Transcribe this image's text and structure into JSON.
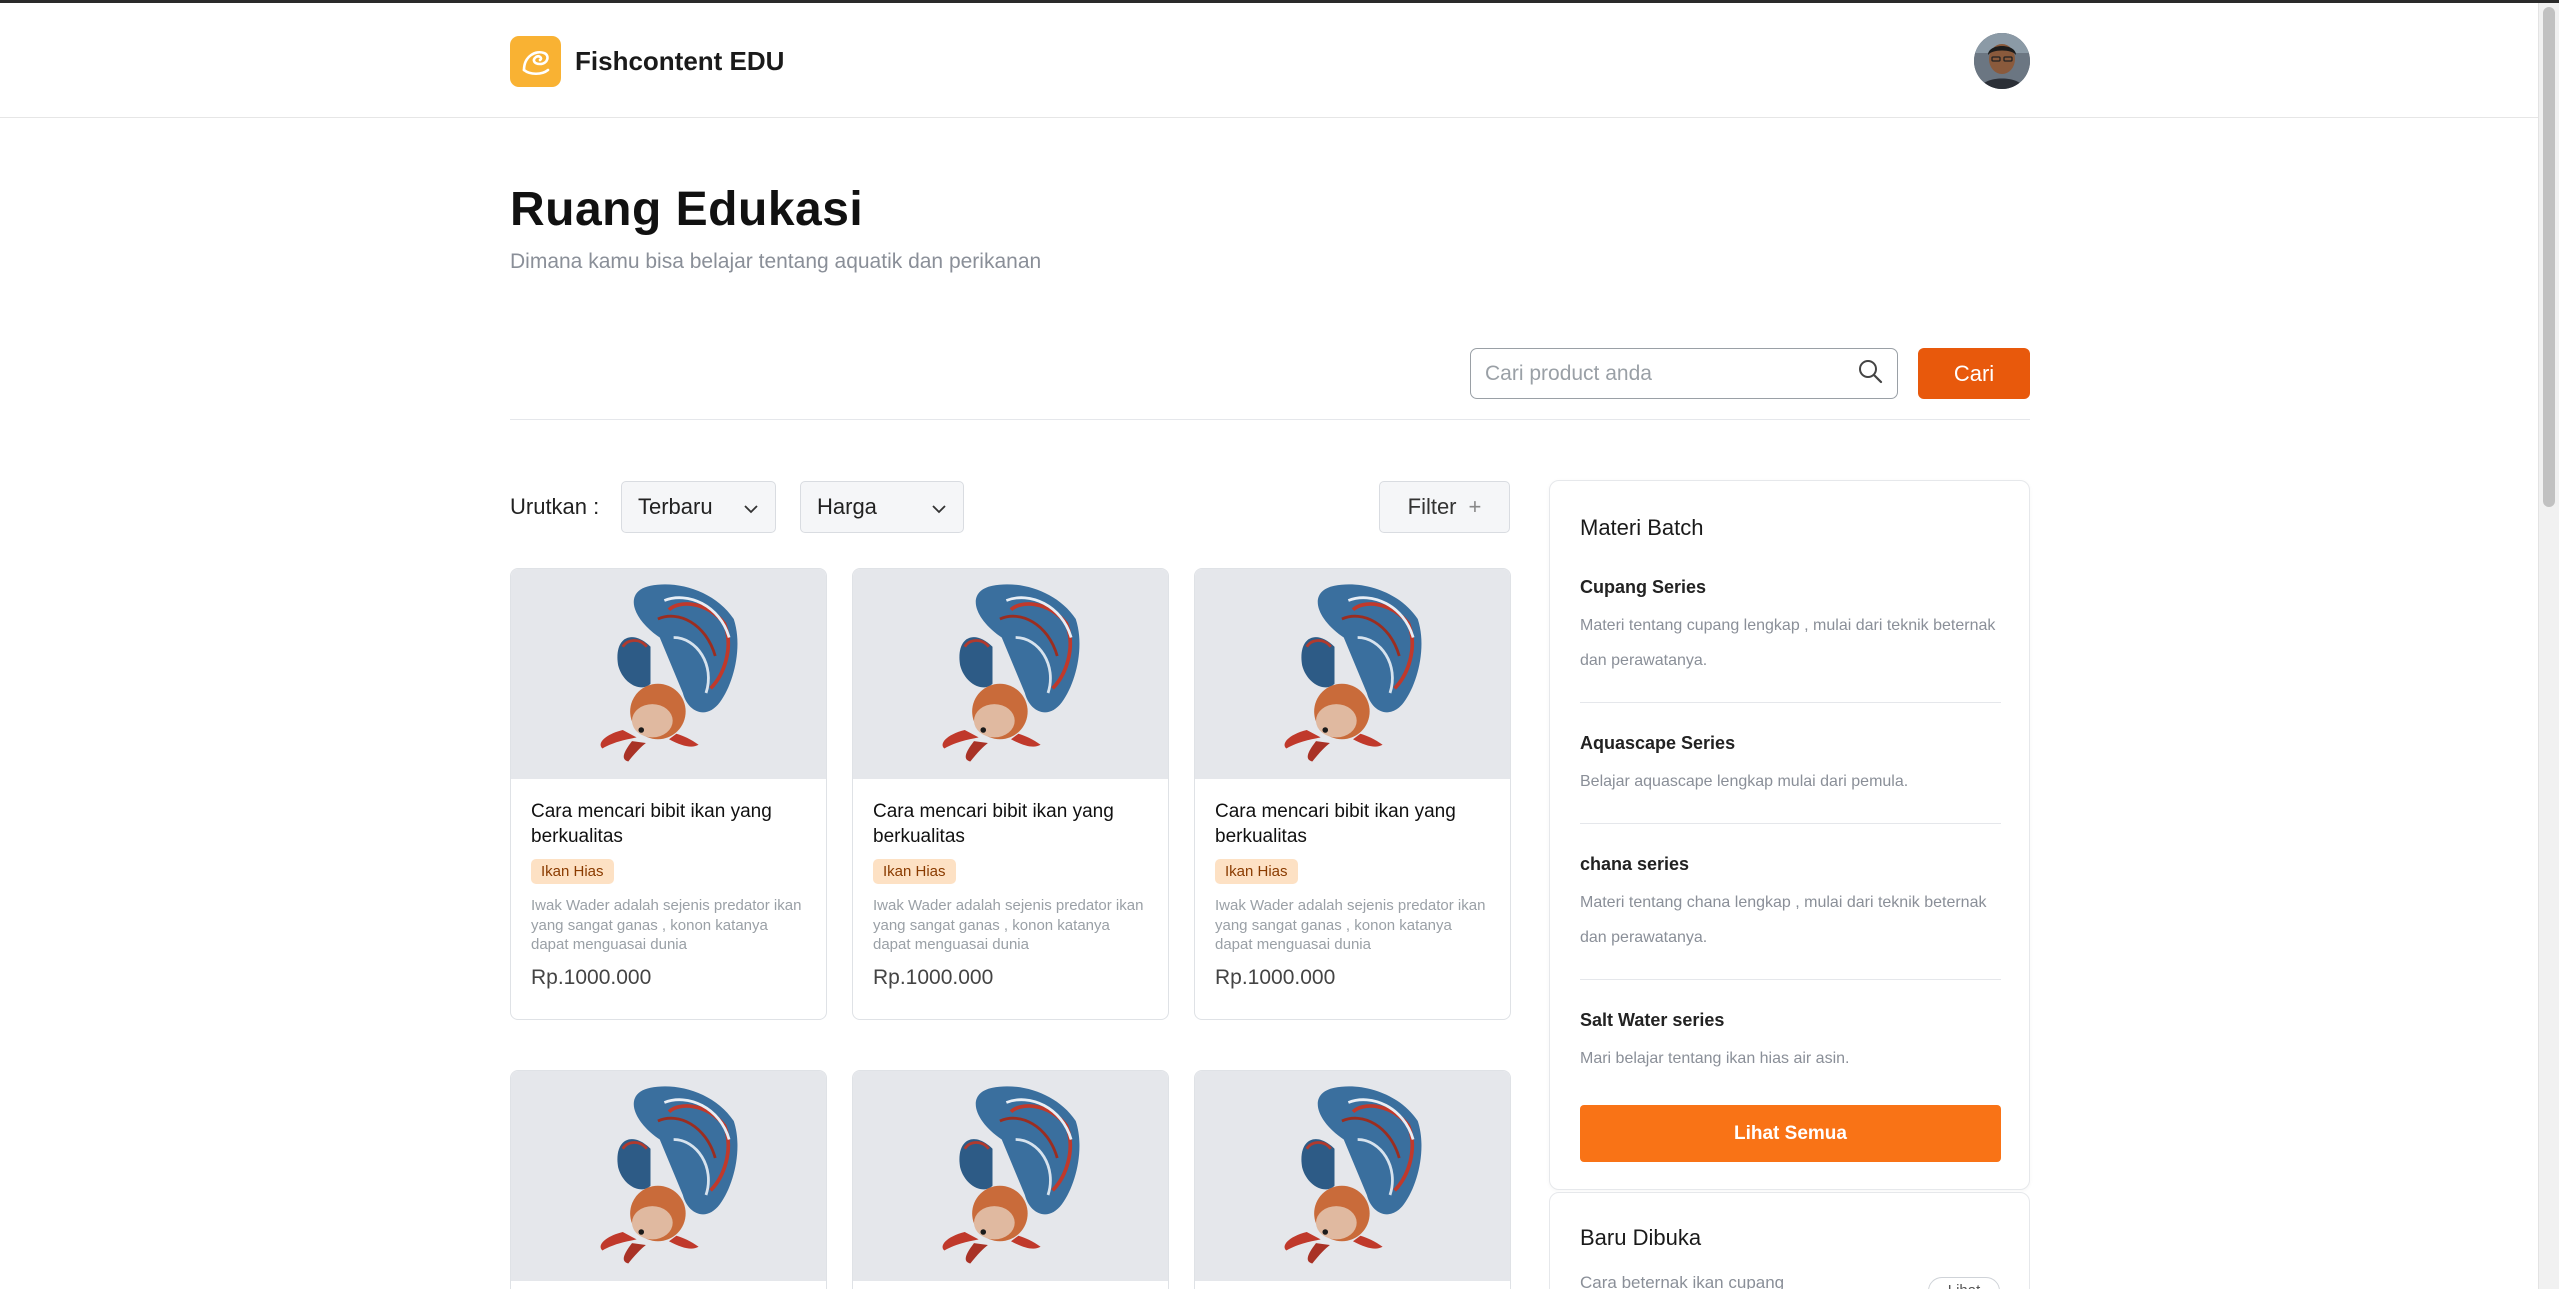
{
  "navbar": {
    "brand": "Fishcontent EDU",
    "logo_icon": "fish-logo-icon",
    "avatar": "user-avatar"
  },
  "header": {
    "title": "Ruang Edukasi",
    "subtitle": "Dimana kamu bisa belajar tentang aquatik dan perikanan"
  },
  "search": {
    "placeholder": "Cari product anda",
    "value": "",
    "button_label": "Cari",
    "icon": "search-icon"
  },
  "sort": {
    "label": "Urutkan :",
    "select1": "Terbaru",
    "select2": "Harga",
    "filter_label": "Filter",
    "filter_icon": "+"
  },
  "cards": [
    {
      "title": "Cara mencari bibit ikan yang berkualitas",
      "tag": "Ikan Hias",
      "desc": "Iwak Wader adalah sejenis predator ikan yang sangat ganas , konon katanya dapat menguasai dunia",
      "price": "Rp.1000.000"
    },
    {
      "title": "Cara mencari bibit ikan yang berkualitas",
      "tag": "Ikan Hias",
      "desc": "Iwak Wader adalah sejenis predator ikan yang sangat ganas , konon katanya dapat menguasai dunia",
      "price": "Rp.1000.000"
    },
    {
      "title": "Cara mencari bibit ikan yang berkualitas",
      "tag": "Ikan Hias",
      "desc": "Iwak Wader adalah sejenis predator ikan yang sangat ganas , konon katanya dapat menguasai dunia",
      "price": "Rp.1000.000"
    }
  ],
  "sidebar": {
    "title": "Materi Batch",
    "items": [
      {
        "name": "Cupang Series",
        "desc": "Materi tentang cupang lengkap , mulai dari teknik beternak dan perawatanya."
      },
      {
        "name": "Aquascape Series",
        "desc": "Belajar aquascape lengkap mulai dari pemula."
      },
      {
        "name": "chana series",
        "desc": "Materi tentang chana lengkap , mulai dari teknik beternak dan perawatanya."
      },
      {
        "name": "Salt Water series",
        "desc": "Mari belajar tentang ikan hias air asin."
      }
    ],
    "see_all": "Lihat Semua"
  },
  "recent": {
    "title": "Baru Dibuka",
    "item": "Cara beternak ikan cupang",
    "view": "Lihat"
  },
  "colors": {
    "accent": "#e8590c",
    "accent_light": "#f97316",
    "logo": "#f9b233",
    "tag_bg": "#fde1c4"
  }
}
